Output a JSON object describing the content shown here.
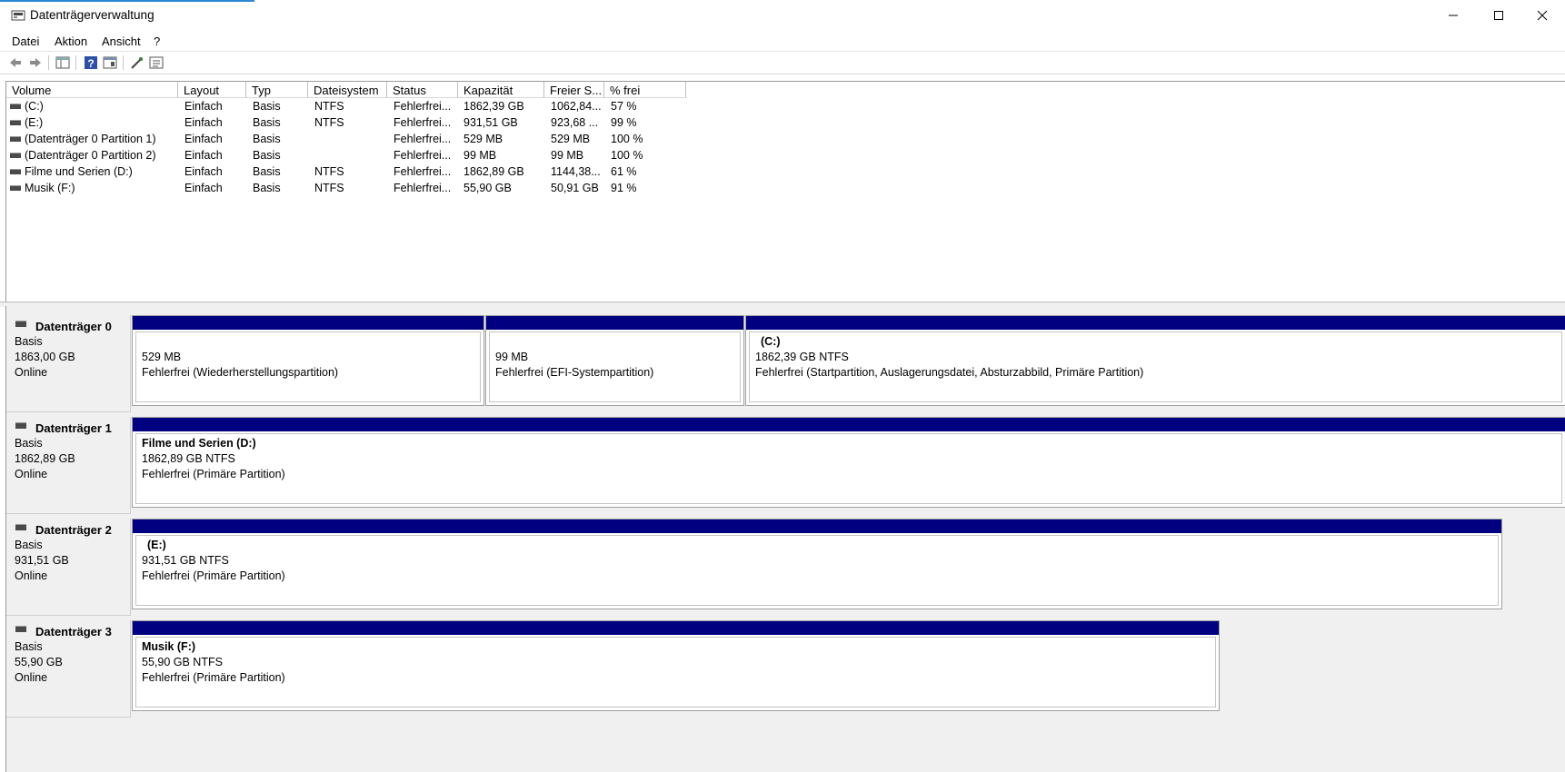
{
  "window": {
    "title": "Datenträgerverwaltung"
  },
  "menu": [
    "Datei",
    "Aktion",
    "Ansicht",
    "?"
  ],
  "toolbar_icons": [
    "back-arrow-icon",
    "forward-arrow-icon",
    "console-tree-icon",
    "help-icon",
    "properties-icon",
    "connect-icon",
    "settings-list-icon"
  ],
  "columns": [
    "Volume",
    "Layout",
    "Typ",
    "Dateisystem",
    "Status",
    "Kapazität",
    "Freier S...",
    "% frei"
  ],
  "volumes": [
    {
      "volume": " (C:)",
      "layout": "Einfach",
      "typ": "Basis",
      "fs": "NTFS",
      "status": "Fehlerfrei...",
      "capacity": "1862,39 GB",
      "free": "1062,84...",
      "pct": "57 %"
    },
    {
      "volume": " (E:)",
      "layout": "Einfach",
      "typ": "Basis",
      "fs": "NTFS",
      "status": "Fehlerfrei...",
      "capacity": "931,51 GB",
      "free": "923,68 ...",
      "pct": "99 %"
    },
    {
      "volume": "(Datenträger 0 Partition 1)",
      "layout": "Einfach",
      "typ": "Basis",
      "fs": "",
      "status": "Fehlerfrei...",
      "capacity": "529 MB",
      "free": "529 MB",
      "pct": "100 %"
    },
    {
      "volume": "(Datenträger 0 Partition 2)",
      "layout": "Einfach",
      "typ": "Basis",
      "fs": "",
      "status": "Fehlerfrei...",
      "capacity": "99 MB",
      "free": "99 MB",
      "pct": "100 %"
    },
    {
      "volume": "Filme und Serien (D:)",
      "layout": "Einfach",
      "typ": "Basis",
      "fs": "NTFS",
      "status": "Fehlerfrei...",
      "capacity": "1862,89 GB",
      "free": "1144,38...",
      "pct": "61 %"
    },
    {
      "volume": "Musik (F:)",
      "layout": "Einfach",
      "typ": "Basis",
      "fs": "NTFS",
      "status": "Fehlerfrei...",
      "capacity": "55,90 GB",
      "free": "50,91 GB",
      "pct": "91 %"
    }
  ],
  "disks": [
    {
      "name": "Datenträger 0",
      "type": "Basis",
      "size": "1863,00 GB",
      "state": "Online",
      "partitions": [
        {
          "name": "",
          "size": "529 MB",
          "status": "Fehlerfrei (Wiederherstellungspartition)"
        },
        {
          "name": "",
          "size": "99 MB",
          "status": "Fehlerfrei (EFI-Systempartition)"
        },
        {
          "name": "(C:)",
          "size": "1862,39 GB NTFS",
          "status": "Fehlerfrei (Startpartition, Auslagerungsdatei, Absturzabbild, Primäre Partition)"
        }
      ]
    },
    {
      "name": "Datenträger 1",
      "type": "Basis",
      "size": "1862,89 GB",
      "state": "Online",
      "partitions": [
        {
          "name": "Filme und Serien  (D:)",
          "size": "1862,89 GB NTFS",
          "status": "Fehlerfrei (Primäre Partition)"
        }
      ]
    },
    {
      "name": "Datenträger 2",
      "type": "Basis",
      "size": "931,51 GB",
      "state": "Online",
      "partitions": [
        {
          "name": "(E:)",
          "size": "931,51 GB NTFS",
          "status": "Fehlerfrei (Primäre Partition)"
        }
      ]
    },
    {
      "name": "Datenträger 3",
      "type": "Basis",
      "size": "55,90 GB",
      "state": "Online",
      "partitions": [
        {
          "name": "Musik  (F:)",
          "size": "55,90 GB NTFS",
          "status": "Fehlerfrei (Primäre Partition)"
        }
      ]
    }
  ],
  "colors": {
    "partition_bar": "#000080",
    "background": "#f0f0f0"
  }
}
